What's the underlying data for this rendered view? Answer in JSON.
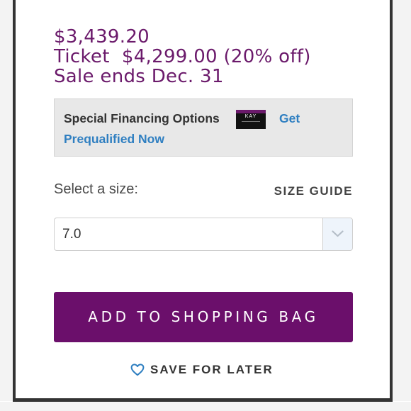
{
  "price": {
    "sale": "$3,439.20",
    "ticket": "Ticket  $4,299.00 (20% off)",
    "sale_ends": "Sale ends Dec. 31"
  },
  "financing": {
    "title": "Special Financing Options",
    "card_brand": "KAY",
    "link_part1": "Get",
    "link_part2": "Prequalified Now"
  },
  "size": {
    "label": "Select a size:",
    "guide": "SIZE GUIDE",
    "selected": "7.0",
    "icon": "chevron-down-icon"
  },
  "actions": {
    "add_to_bag": "ADD TO SHOPPING BAG",
    "save_for_later": "SAVE FOR LATER",
    "save_icon": "heart-outline-icon"
  },
  "colors": {
    "brand_purple": "#6b0f6b",
    "price_purple": "#6b1a6b",
    "link_blue": "#2f7fc1"
  }
}
